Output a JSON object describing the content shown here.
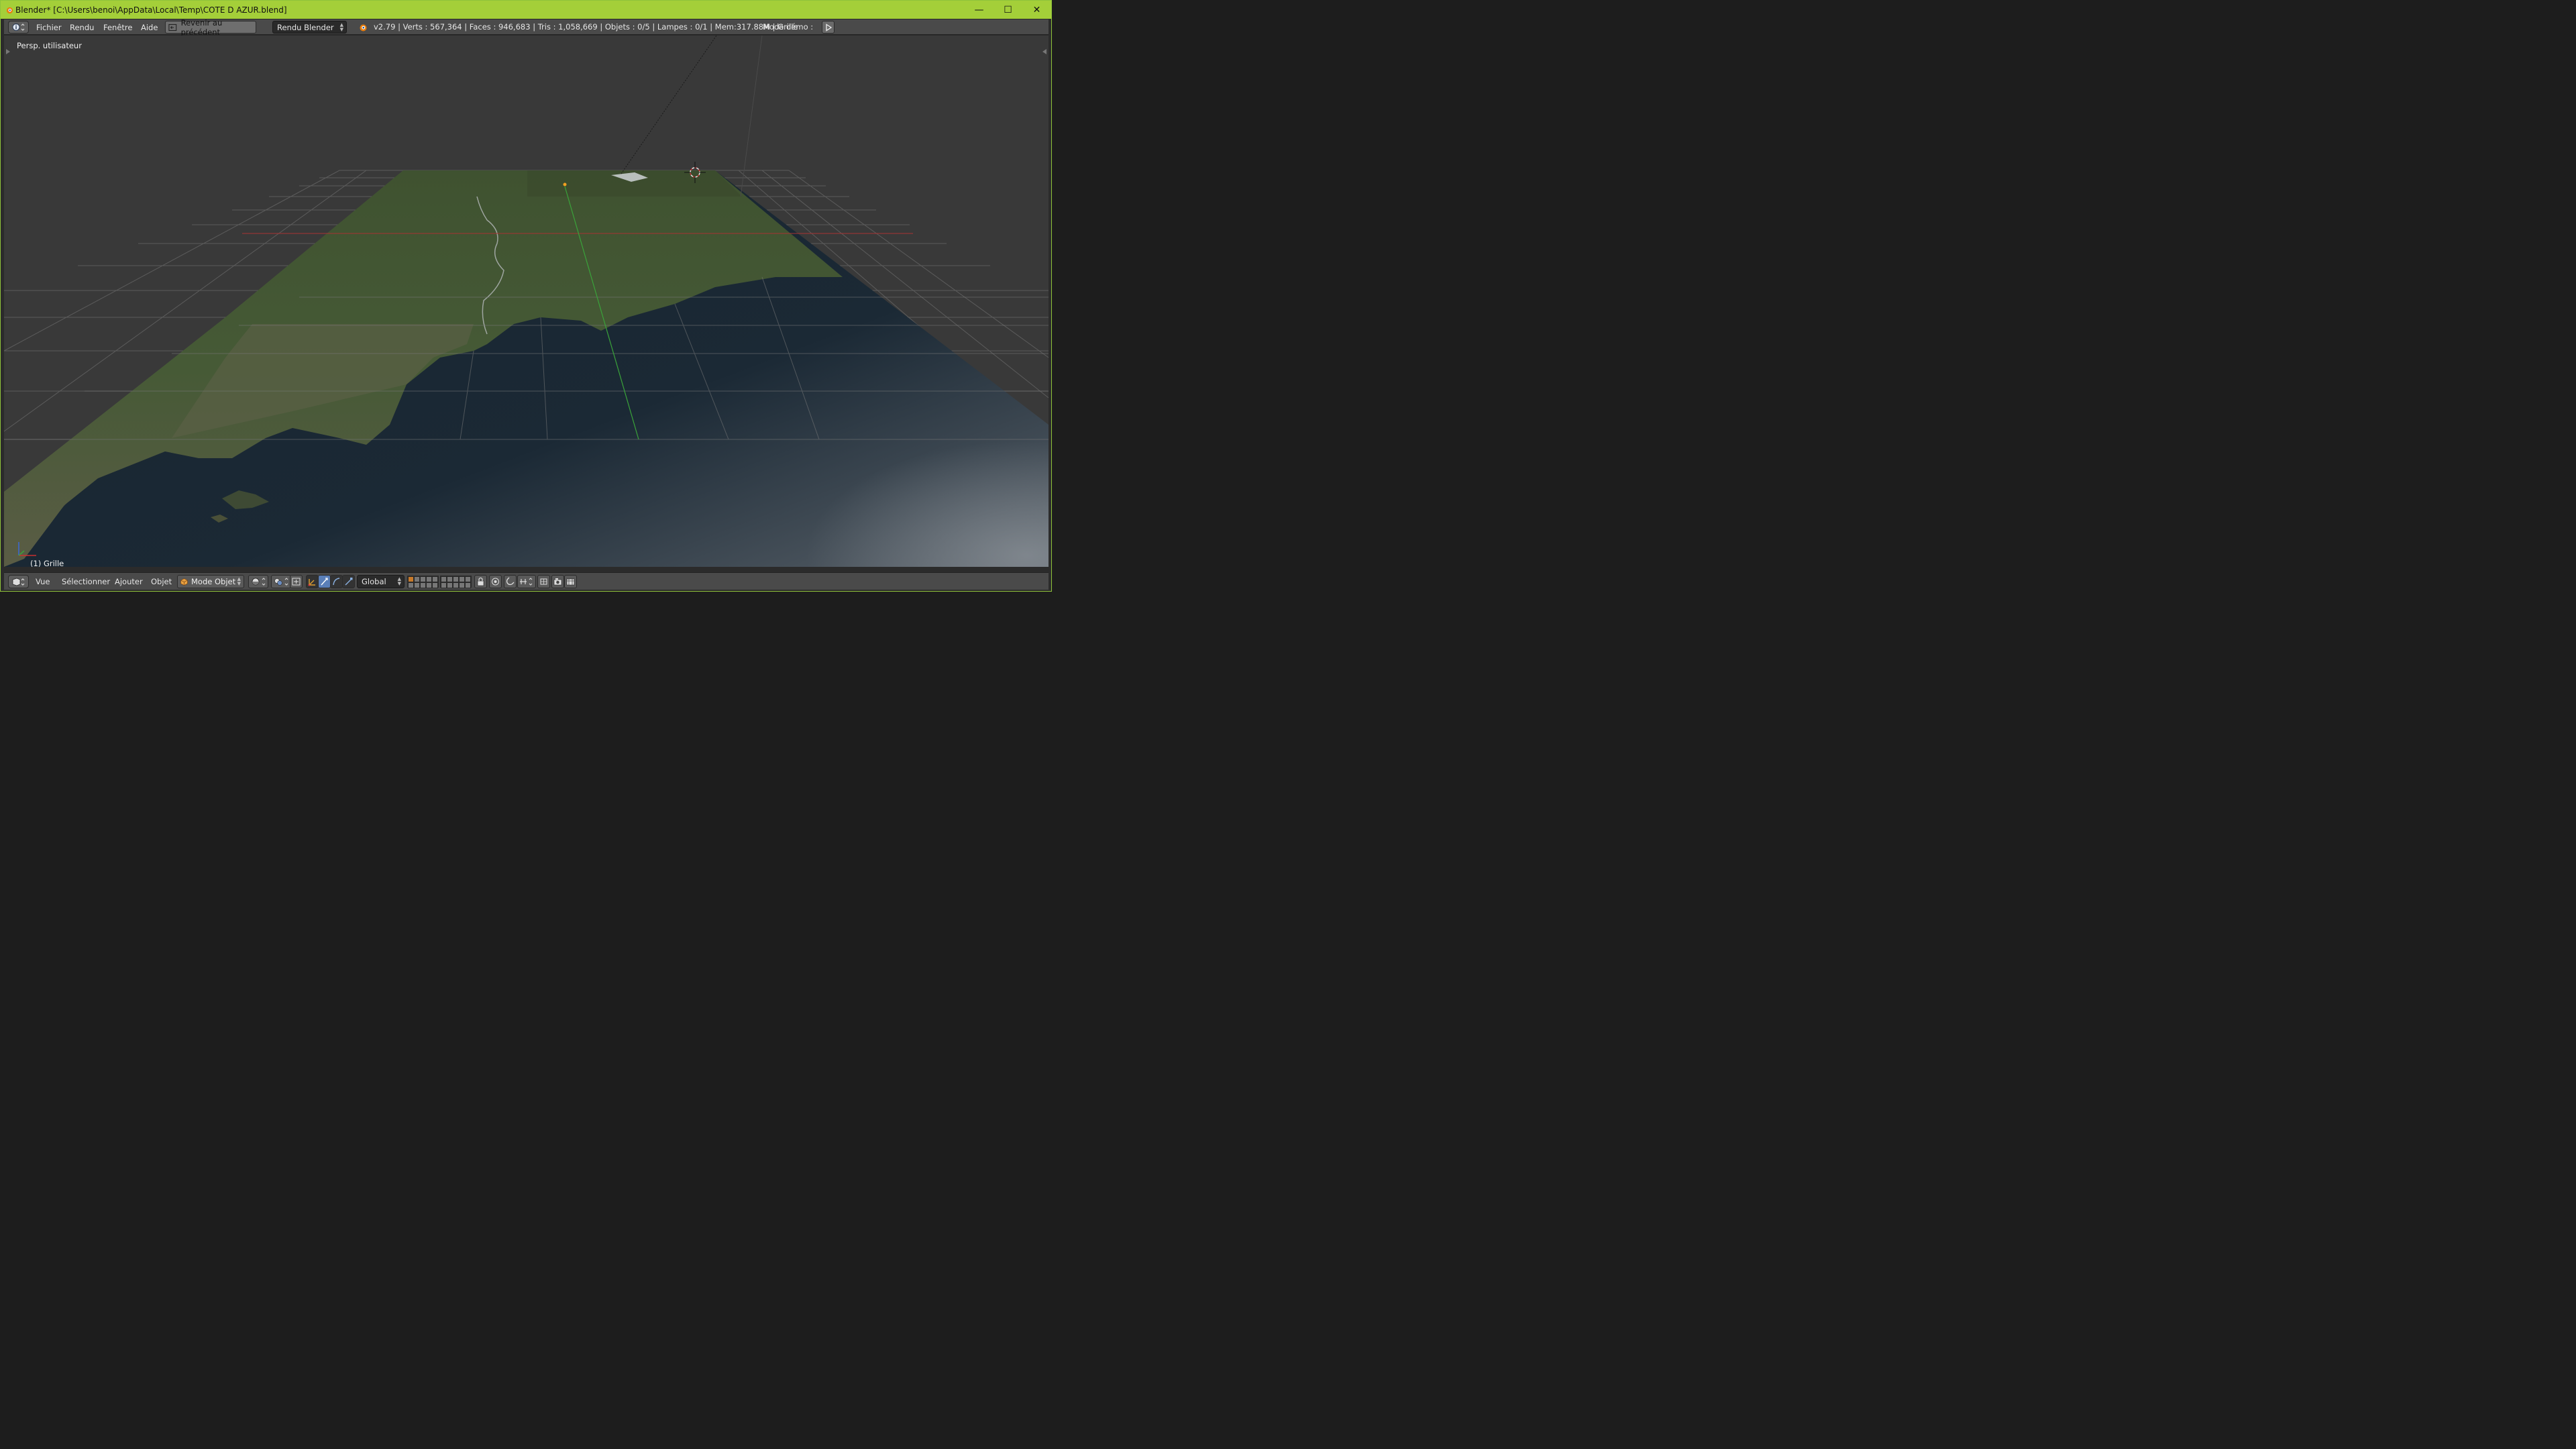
{
  "window": {
    "title": "Blender* [C:\\Users\\benoi\\AppData\\Local\\Temp\\COTE D AZUR.blend]",
    "controls": {
      "minimize": "—",
      "maximize": "☐",
      "close": "✕"
    }
  },
  "info_header": {
    "menus": [
      "Fichier",
      "Rendu",
      "Fenêtre",
      "Aide"
    ],
    "back_button": "Revenir au précédent",
    "render_engine": "Rendu Blender",
    "stats": "v2.79 | Verts  : 567,364 | Faces  : 946,683 | Tris  : 1,058,669 | Objets  : 0/5 | Lampes  : 0/1 | Mem:317.88M | Grille",
    "demo_mode_label": "Mode démo  :"
  },
  "viewport": {
    "view_label": "Persp. utilisateur",
    "object_label": "(1) Grille",
    "colors": {
      "background": "#393939",
      "grid": "#6a6a6a",
      "x_axis": "#a83232",
      "y_axis": "#3aa33a",
      "sea": "#1e2e3c",
      "land": "#4a5a38"
    }
  },
  "view3d_header": {
    "menus": [
      "Vue",
      "Sélectionner",
      "Ajouter",
      "Objet"
    ],
    "mode": "Mode Objet",
    "orientation": "Global",
    "icons": [
      "editor-type-icon",
      "viewport-shading-icon",
      "pivot-icon",
      "manipulator-icon",
      "translate-icon",
      "rotate-icon",
      "scale-icon",
      "layers-icon",
      "lock-icon",
      "proportional-edit-icon",
      "snap-icon",
      "render-icon",
      "anim-icon"
    ]
  }
}
